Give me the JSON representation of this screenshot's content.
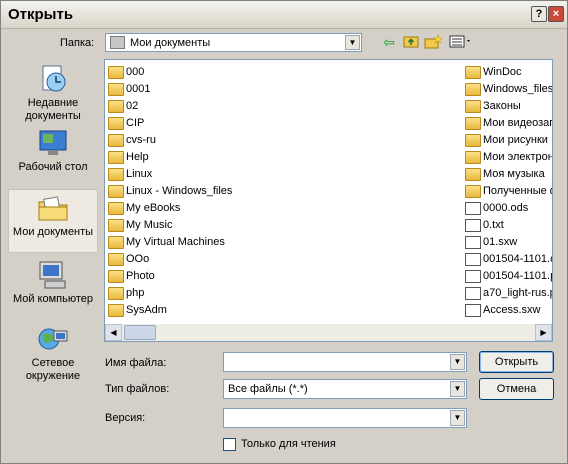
{
  "window": {
    "title": "Открыть",
    "help_glyph": "?",
    "close_glyph": "×"
  },
  "lookin": {
    "label": "Папка:",
    "value": "Мои документы"
  },
  "places": [
    {
      "label": "Недавние документы",
      "icon": "recent-documents-icon"
    },
    {
      "label": "Рабочий стол",
      "icon": "desktop-icon"
    },
    {
      "label": "Мои документы",
      "icon": "my-documents-icon",
      "selected": true
    },
    {
      "label": "Мой компьютер",
      "icon": "my-computer-icon"
    },
    {
      "label": "Сетевое окружение",
      "icon": "network-icon"
    }
  ],
  "files_col1": [
    "000",
    "0001",
    "02",
    "CIP",
    "cvs-ru",
    "Help",
    "Linux",
    "Linux - Windows_files",
    "My eBooks",
    "My Music",
    "My Virtual Machines",
    "OOo",
    "Photo",
    "php",
    "SysAdm"
  ],
  "files_col2": [
    "WinDoc",
    "Windows_files",
    "Законы",
    "Мои видеозап",
    "Мои рисунки",
    "Мои электрон",
    "Моя музыка",
    "Полученные ф",
    "0000.ods",
    "0.txt",
    "01.sxw",
    "001504-1101.c",
    "001504-1101.p",
    "a70_light-rus.p",
    "Access.sxw"
  ],
  "files_col2_types": [
    "folder",
    "folder",
    "folder",
    "folder",
    "folder",
    "folder",
    "folder",
    "folder",
    "doc",
    "doc",
    "doc",
    "doc",
    "doc",
    "doc",
    "doc"
  ],
  "form": {
    "filename_label": "Имя файла:",
    "filename_value": "",
    "filetype_label": "Тип файлов:",
    "filetype_value": "Все файлы (*.*)",
    "version_label": "Версия:",
    "version_value": "",
    "readonly_label": "Только для чтения"
  },
  "buttons": {
    "open": "Открыть",
    "cancel": "Отмена"
  }
}
